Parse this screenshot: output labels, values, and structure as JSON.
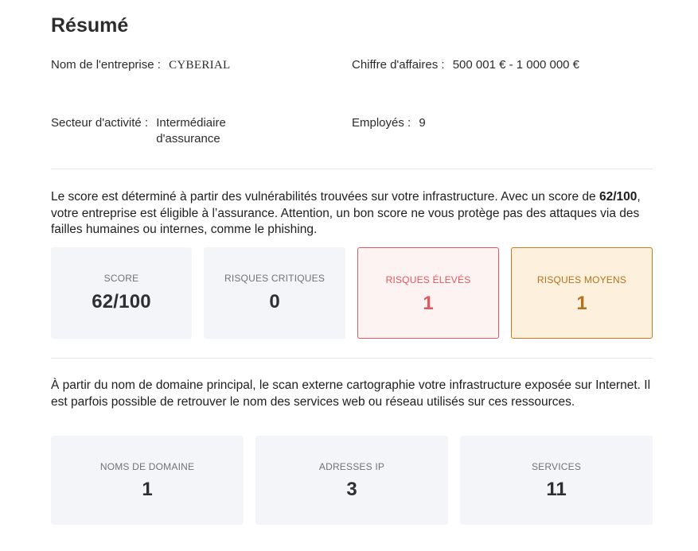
{
  "title": "Résumé",
  "company": {
    "name_label": "Nom de l'entreprise :",
    "name_value": "CYBERIAL",
    "revenue_label": "Chiffre d'affaires :",
    "revenue_value": "500 001 € - 1 000 000 €",
    "sector_label": "Secteur d'activité :",
    "sector_value_line1": "Intermédiaire",
    "sector_value_line2": "d'assurance",
    "employees_label": "Employés :",
    "employees_value": "9"
  },
  "score_text": {
    "before": "Le score est déterminé à partir des vulnérabilités trouvées sur votre infrastructure. Avec un score de ",
    "bold": "62/100",
    "after": ", votre entreprise est éligible à l’assurance. Attention, un bon score ne vous protège pas des attaques via des failles humaines ou internes, comme le phishing."
  },
  "score_cards": [
    {
      "label": "SCORE",
      "value": "62/100"
    },
    {
      "label": "RISQUES CRITIQUES",
      "value": "0"
    },
    {
      "label": "RISQUES ÉLEVÉS",
      "value": "1",
      "color": "#e0575d"
    },
    {
      "label": "RISQUES MOYENS",
      "value": "1",
      "color": "#b2721e"
    }
  ],
  "scan_text": "À partir du nom de domaine principal, le scan externe cartographie votre infrastructure exposée sur Internet. Il est parfois possible de retrouver le nom des services web ou réseau utilisés sur ces ressources.",
  "scan_cards": [
    {
      "label": "NOMS DE DOMAINE",
      "value": "1"
    },
    {
      "label": "ADRESSES IP",
      "value": "3"
    },
    {
      "label": "SERVICES",
      "value": "11"
    }
  ]
}
